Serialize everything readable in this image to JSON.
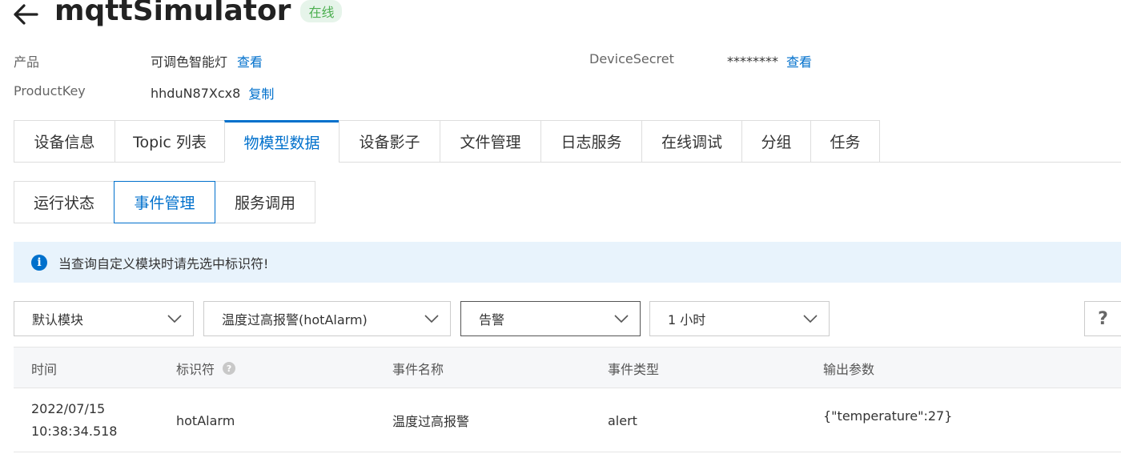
{
  "header": {
    "title": "mqttSimulator",
    "status": "在线"
  },
  "info": {
    "product_label": "产品",
    "product_value": "可调色智能灯",
    "product_link": "查看",
    "productkey_label": "ProductKey",
    "productkey_value": "hhduN87Xcx8",
    "productkey_link": "复制",
    "secret_label": "DeviceSecret",
    "secret_value": "********",
    "secret_link": "查看"
  },
  "tabs": [
    {
      "label": "设备信息"
    },
    {
      "label": "Topic 列表"
    },
    {
      "label": "物模型数据"
    },
    {
      "label": "设备影子"
    },
    {
      "label": "文件管理"
    },
    {
      "label": "日志服务"
    },
    {
      "label": "在线调试"
    },
    {
      "label": "分组"
    },
    {
      "label": "任务"
    }
  ],
  "subtabs": [
    {
      "label": "运行状态"
    },
    {
      "label": "事件管理"
    },
    {
      "label": "服务调用"
    }
  ],
  "notice": {
    "icon": "info-icon",
    "text": "当查询自定义模块时请先选中标识符!"
  },
  "filters": {
    "module": "默认模块",
    "event": "温度过高报警(hotAlarm)",
    "type": "告警",
    "time_range": "1 小时",
    "help": "?"
  },
  "table": {
    "columns": [
      "时间",
      "标识符",
      "事件名称",
      "事件类型",
      "输出参数"
    ],
    "rows": [
      {
        "date": "2022/07/15",
        "time": "10:38:34.518",
        "identifier": "hotAlarm",
        "name": "温度过高报警",
        "type": "alert",
        "output": "{\"temperature\":27}"
      }
    ]
  },
  "colors": {
    "accent": "#0070cc",
    "status": "#4caf50",
    "notice_bg": "#e8f3fc"
  }
}
